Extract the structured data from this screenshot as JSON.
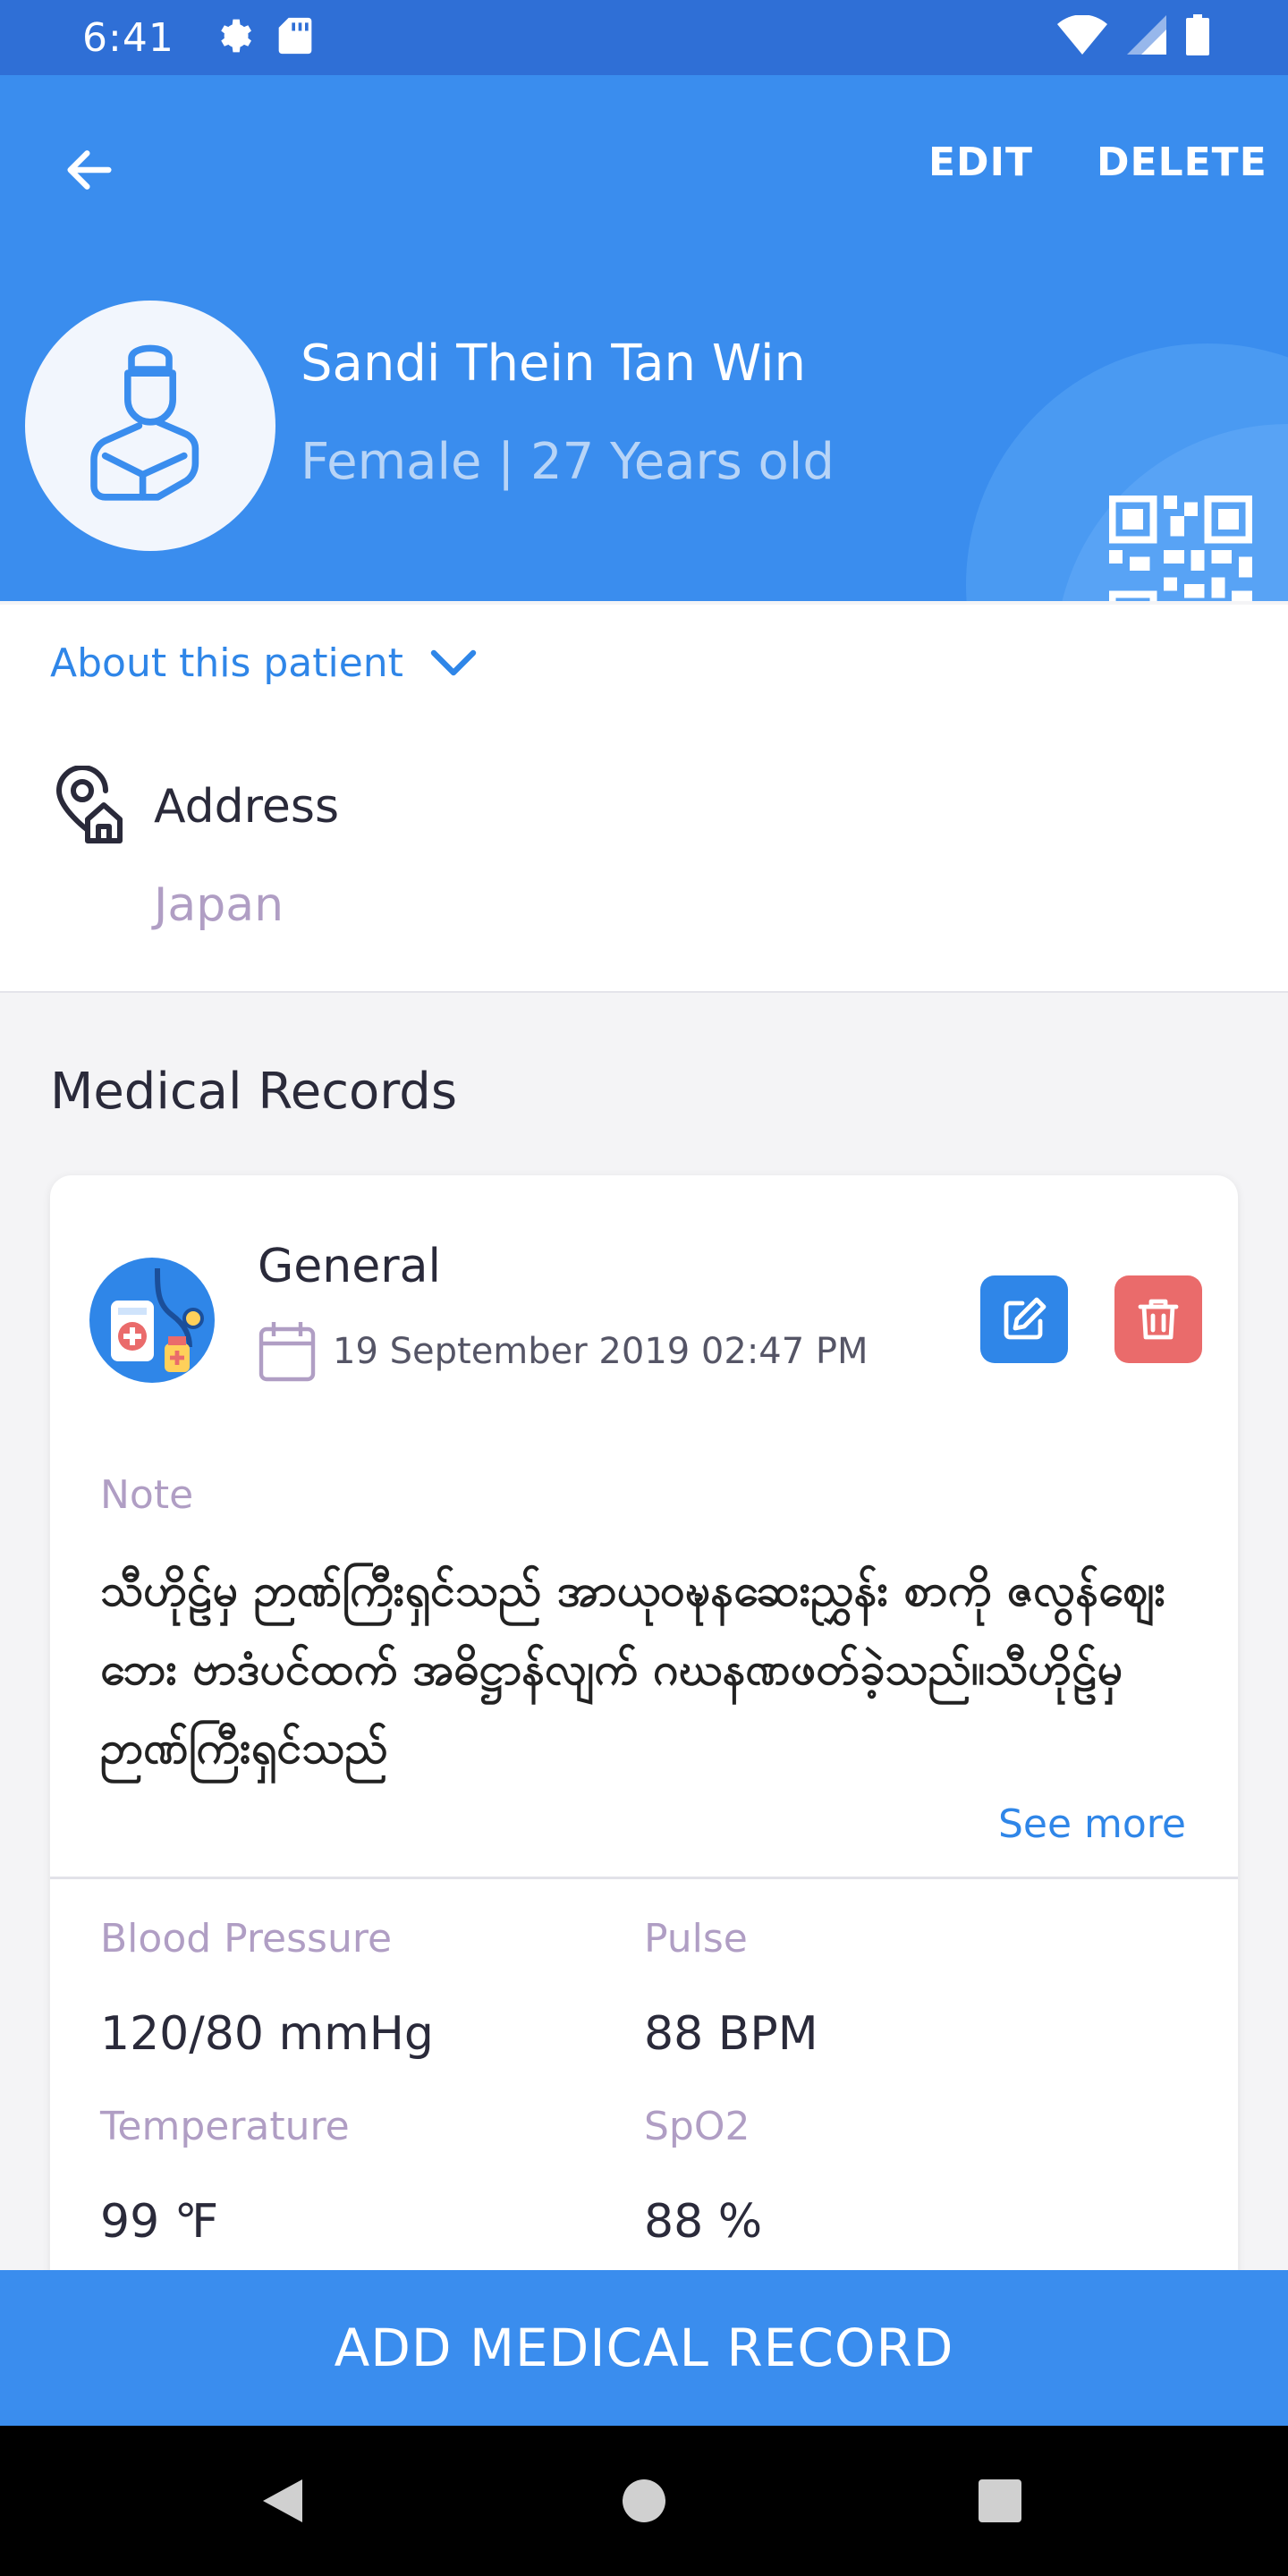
{
  "status": {
    "time": "6:41"
  },
  "header": {
    "edit_label": "EDIT",
    "delete_label": "DELETE",
    "patient_name": "Sandi Thein Tan Win",
    "patient_info": "Female | 27 Years old"
  },
  "about": {
    "toggle_label": "About this patient",
    "address_label": "Address",
    "address_value": "Japan"
  },
  "records": {
    "title": "Medical Records",
    "items": [
      {
        "type": "General",
        "date": "19 September 2019 02:47 PM",
        "note_label": "Note",
        "note_text": "သီဟိုဠ်မှ ဉာဏ်ကြီးရှင်သည် အာယုဝဍ္ဎနဆေးညွှန်း စာကို ဇလွန်ဈေးဘေး ဗာဒံပင်ထက် အဓိဋ္ဌာန်လျက် ဂဃနဏဖတ်ခဲ့သည်။သီဟိုဠ်မှ ဉာဏ်ကြီးရှင်သည်",
        "see_more": "See more",
        "vitals": [
          {
            "label": "Blood Pressure",
            "value": "120/80 mmHg"
          },
          {
            "label": "Pulse",
            "value": "88 BPM"
          },
          {
            "label": "Temperature",
            "value": "99 ℉"
          },
          {
            "label": "SpO2",
            "value": "88 %"
          }
        ]
      }
    ]
  },
  "footer": {
    "add_label": "ADD MEDICAL RECORD"
  },
  "colors": {
    "primary": "#3a8dee",
    "accent_blue": "#2f86e8",
    "danger": "#ea6b6b",
    "muted_label": "#b09ec4"
  }
}
